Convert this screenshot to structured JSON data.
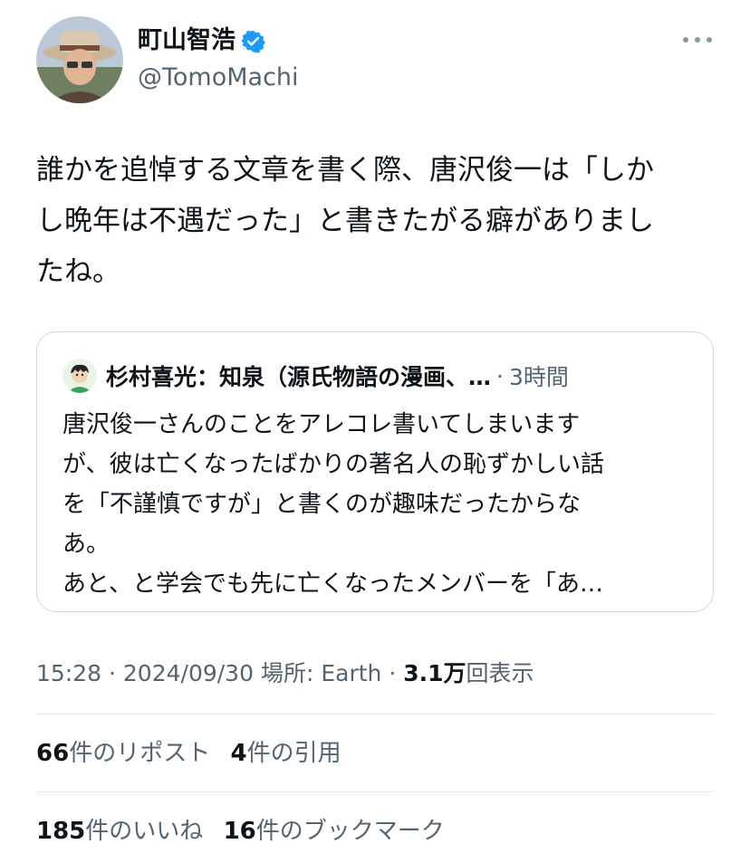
{
  "author": {
    "name": "町山智浩",
    "handle": "@TomoMachi",
    "verified_color": "#1d9bf0"
  },
  "tweet": {
    "text": "誰かを追悼する文章を書く際、唐沢俊一は「しか\nし晩年は不遇だった」と書きたがる癖がありまし\nたね。"
  },
  "quote": {
    "name": "杉村喜光：知泉（源氏物語の漫画、…",
    "time": "3時間",
    "text": "唐沢俊一さんのことをアレコレ書いてしまいます\nが、彼は亡くなったばかりの著名人の恥ずかしい話\nを「不謹慎ですが」と書くのが趣味だったからな\nあ。\nあと、と学会でも先に亡くなったメンバーを「あ…"
  },
  "meta": {
    "time": "15:28",
    "date": "2024/09/30",
    "location_label": "場所: Earth",
    "views": "3.1万",
    "views_label": "回表示"
  },
  "stats": {
    "reposts": "66",
    "reposts_label": "件のリポスト",
    "quotes": "4",
    "quotes_label": "件の引用",
    "likes": "185",
    "likes_label": "件のいいね",
    "bookmarks": "16",
    "bookmarks_label": "件のブックマーク"
  }
}
